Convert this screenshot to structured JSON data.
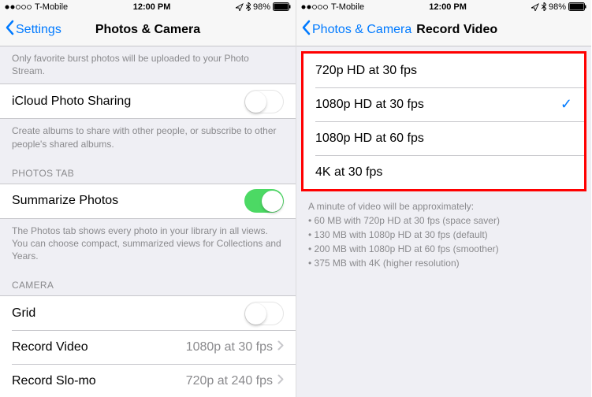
{
  "status": {
    "carrier": "T-Mobile",
    "time": "12:00 PM",
    "battery": "98%"
  },
  "left": {
    "back": "Settings",
    "title": "Photos & Camera",
    "burst_footer": "Only favorite burst photos will be uploaded to your Photo Stream.",
    "icloud_label": "iCloud Photo Sharing",
    "icloud_footer": "Create albums to share with other people, or subscribe to other people's shared albums.",
    "photos_tab_header": "PHOTOS TAB",
    "summarize_label": "Summarize Photos",
    "summarize_footer": "The Photos tab shows every photo in your library in all views. You can choose compact, summarized views for Collections and Years.",
    "camera_header": "CAMERA",
    "grid_label": "Grid",
    "record_video_label": "Record Video",
    "record_video_value": "1080p at 30 fps",
    "record_slomo_label": "Record Slo-mo",
    "record_slomo_value": "720p at 240 fps"
  },
  "right": {
    "back": "Photos & Camera",
    "title": "Record Video",
    "options": {
      "0": "720p HD at 30 fps",
      "1": "1080p HD at 30 fps",
      "2": "1080p HD at 60 fps",
      "3": "4K at 30 fps"
    },
    "selected": 1,
    "info_header": "A minute of video will be approximately:",
    "info": {
      "0": "• 60 MB with 720p HD at 30 fps (space saver)",
      "1": "• 130 MB with 1080p HD at 30 fps (default)",
      "2": "• 200 MB with 1080p HD at 60 fps (smoother)",
      "3": "• 375 MB with 4K (higher resolution)"
    }
  }
}
